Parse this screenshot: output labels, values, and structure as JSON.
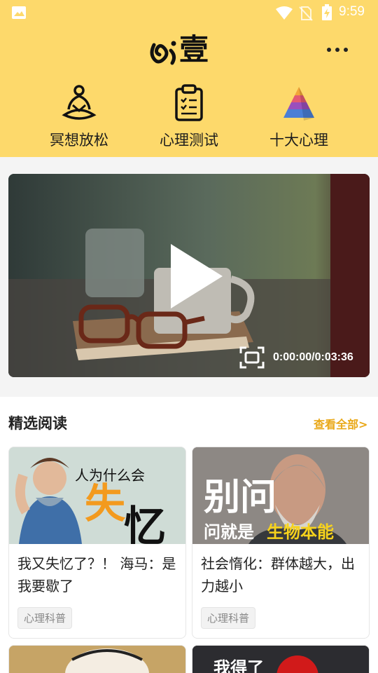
{
  "status_bar": {
    "time": "9:59"
  },
  "header": {
    "logo_text": "壹",
    "quick_actions": [
      {
        "label": "冥想放松",
        "icon": "meditation-icon"
      },
      {
        "label": "心理测试",
        "icon": "clipboard-icon"
      },
      {
        "label": "十大心理",
        "icon": "pyramid-icon"
      }
    ]
  },
  "video": {
    "time": "0:00:00/0:03:36"
  },
  "featured": {
    "title": "精选阅读",
    "see_all": "查看全部>",
    "cards": [
      {
        "title": "我又失忆了？！ 海马：是我要歇了",
        "tag": "心理科普",
        "thumb_text_top": "人为什么会",
        "thumb_text_big1": "失",
        "thumb_text_big2": "忆"
      },
      {
        "title": "社会惰化：群体越大，出力越小",
        "tag": "心理科普",
        "thumb_text_top": "别问",
        "thumb_text_left": "问就是",
        "thumb_text_right": "生物本能"
      }
    ],
    "next_cards": [
      {
        "thumb_text": ""
      },
      {
        "thumb_text": "我得了"
      }
    ]
  },
  "colors": {
    "accent": "#fdd96b",
    "link": "#e9a818"
  }
}
